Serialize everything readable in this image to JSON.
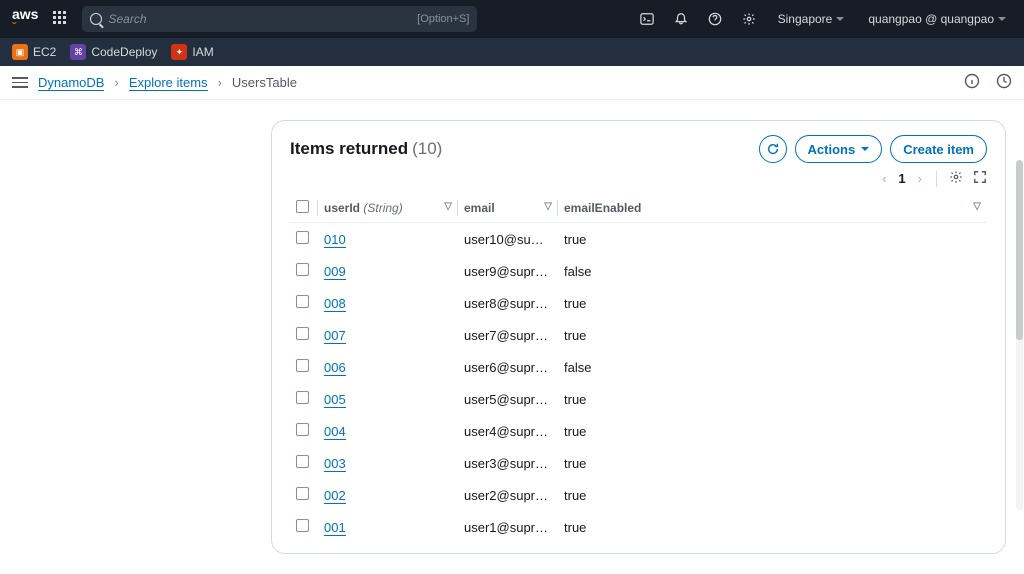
{
  "topbar": {
    "logo_text": "aws",
    "search_placeholder": "Search",
    "search_kbd": "[Option+S]",
    "region": "Singapore",
    "user": "quangpao @ quangpao"
  },
  "shortcuts": [
    {
      "label": "EC2",
      "icon_class": "ec2"
    },
    {
      "label": "CodeDeploy",
      "icon_class": "cdeploy"
    },
    {
      "label": "IAM",
      "icon_class": "iam"
    }
  ],
  "breadcrumbs": {
    "a": "DynamoDB",
    "b": "Explore items",
    "c": "UsersTable"
  },
  "panel": {
    "title": "Items returned",
    "count_label": "(10)",
    "actions_label": "Actions",
    "create_label": "Create item",
    "page": "1"
  },
  "columns": {
    "userId_label": "userId",
    "userId_type": "(String)",
    "email": "email",
    "emailEnabled": "emailEnabled"
  },
  "rows": [
    {
      "id": "010",
      "email": "user10@su…",
      "enabled": "true"
    },
    {
      "id": "009",
      "email": "user9@supr…",
      "enabled": "false"
    },
    {
      "id": "008",
      "email": "user8@supr…",
      "enabled": "true"
    },
    {
      "id": "007",
      "email": "user7@supr…",
      "enabled": "true"
    },
    {
      "id": "006",
      "email": "user6@supr…",
      "enabled": "false"
    },
    {
      "id": "005",
      "email": "user5@supr…",
      "enabled": "true"
    },
    {
      "id": "004",
      "email": "user4@supr…",
      "enabled": "true"
    },
    {
      "id": "003",
      "email": "user3@supr…",
      "enabled": "true"
    },
    {
      "id": "002",
      "email": "user2@supr…",
      "enabled": "true"
    },
    {
      "id": "001",
      "email": "user1@supr…",
      "enabled": "true"
    }
  ]
}
